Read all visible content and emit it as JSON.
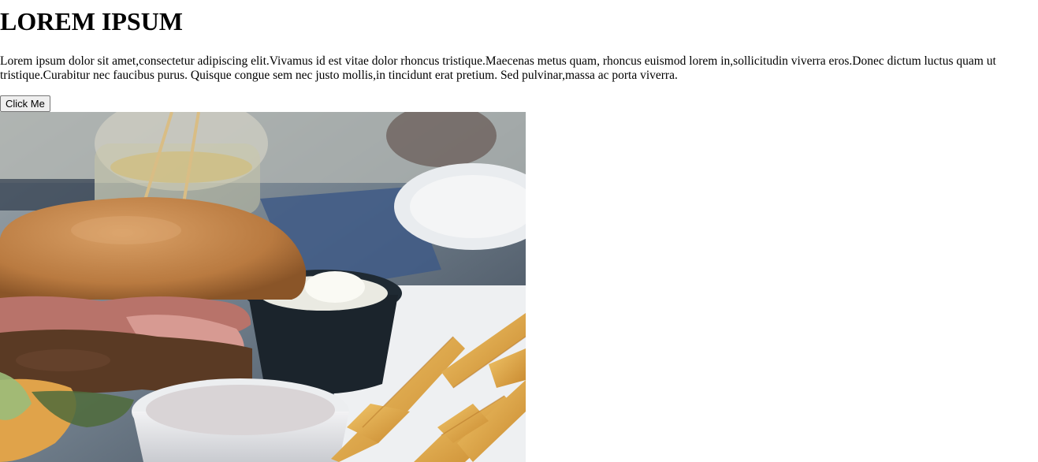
{
  "page": {
    "heading": "LOREM IPSUM",
    "paragraph": "Lorem ipsum dolor sit amet,consectetur adipiscing elit.Vivamus id est vitae dolor rhoncus tristique.Maecenas metus quam, rhoncus euismod lorem in,sollicitudin viverra eros.Donec dictum luctus quam ut tristique.Curabitur nec faucibus purus. Quisque congue sem nec justo mollis,in tincidunt erat pretium. Sed pulvinar,massa ac porta viverra.",
    "button_label": "Click Me"
  },
  "image": {
    "subject": "burger-and-fries-photo",
    "colors": {
      "bun": "#c98a4e",
      "bacon": "#b8736a",
      "patty": "#5a3a24",
      "fries": "#e8b55a",
      "sauce_cup": "#e6e6e8",
      "dark_cup": "#1f2a33",
      "plate": "#e9ecef",
      "background_blue": "#3f5a86"
    }
  }
}
